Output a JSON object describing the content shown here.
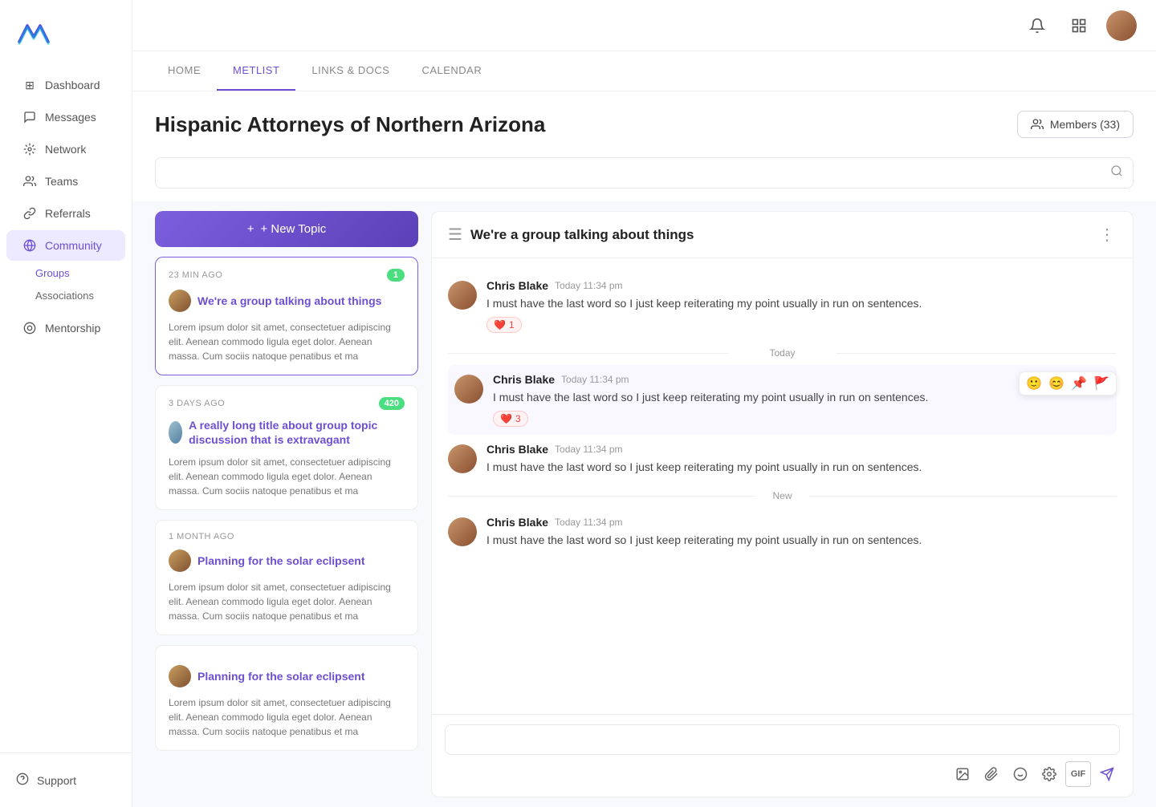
{
  "app": {
    "logo_alt": "App Logo"
  },
  "sidebar": {
    "items": [
      {
        "id": "dashboard",
        "label": "Dashboard",
        "icon": "⊞"
      },
      {
        "id": "messages",
        "label": "Messages",
        "icon": "💬"
      },
      {
        "id": "network",
        "label": "Network",
        "icon": "⬡"
      },
      {
        "id": "teams",
        "label": "Teams",
        "icon": "👥"
      },
      {
        "id": "referrals",
        "label": "Referrals",
        "icon": "🔗"
      },
      {
        "id": "community",
        "label": "Community",
        "icon": "🌐",
        "active": true
      }
    ],
    "community_sub": [
      {
        "id": "groups",
        "label": "Groups",
        "active": true
      },
      {
        "id": "associations",
        "label": "Associations"
      }
    ],
    "bottom": [
      {
        "id": "mentorship",
        "label": "Mentorship",
        "icon": "◎"
      },
      {
        "id": "support",
        "label": "Support",
        "icon": "?"
      }
    ]
  },
  "tabs": [
    {
      "id": "home",
      "label": "HOME"
    },
    {
      "id": "metlist",
      "label": "METLIST",
      "active": true
    },
    {
      "id": "links_docs",
      "label": "LINKS & DOCS"
    },
    {
      "id": "calendar",
      "label": "CALENDAR"
    }
  ],
  "group": {
    "title": "Hispanic Attorneys of Northern Arizona",
    "members_label": "Members (33)"
  },
  "search": {
    "placeholder": ""
  },
  "new_topic_btn": "+ New Topic",
  "topics": [
    {
      "id": 1,
      "time": "23 MIN AGO",
      "badge": "1",
      "badge_color": "green",
      "title": "We're a group talking about things",
      "body": "Lorem ipsum dolor sit amet, consectetuer adipiscing elit. Aenean commodo ligula eget dolor. Aenean massa. Cum sociis natoque penatibus et ma",
      "active": true
    },
    {
      "id": 2,
      "time": "3 DAYS AGO",
      "badge": "420",
      "badge_color": "green",
      "title": "A really long title about group topic discussion that is extravagant",
      "body": "Lorem ipsum dolor sit amet, consectetuer adipiscing elit. Aenean commodo ligula eget dolor. Aenean massa. Cum sociis natoque penatibus et ma"
    },
    {
      "id": 3,
      "time": "1 MONTH AGO",
      "badge": "",
      "title": "Planning for the solar eclipsent",
      "body": "Lorem ipsum dolor sit amet, consectetuer adipiscing elit. Aenean commodo ligula eget dolor. Aenean massa. Cum sociis natoque penatibus et ma"
    },
    {
      "id": 4,
      "time": "",
      "badge": "",
      "title": "Planning for the solar eclipsent",
      "body": "Lorem ipsum dolor sit amet, consectetuer adipiscing elit. Aenean commodo ligula eget dolor. Aenean massa. Cum sociis natoque penatibus et ma"
    }
  ],
  "discussion": {
    "title": "We're a group talking about things",
    "messages": [
      {
        "id": 1,
        "author": "Chris Blake",
        "time": "Today 11:34 pm",
        "text": "I must have the last word so I just keep reiterating my point usually in run on sentences.",
        "reactions": [
          {
            "emoji": "❤️",
            "count": "1"
          }
        ],
        "show_divider_after": false
      },
      {
        "id": 2,
        "divider_before": "Today",
        "author": "Chris Blake",
        "time": "Today 11:34 pm",
        "text": "I must have the last word so I just keep reiterating my point usually in run on sentences.",
        "reactions": [
          {
            "emoji": "❤️",
            "count": "3"
          }
        ],
        "show_actions": true
      },
      {
        "id": 3,
        "author": "Chris Blake",
        "time": "Today 11:34 pm",
        "text": "I must have the last word so I just keep reiterating my point usually in run on sentences.",
        "reactions": [],
        "divider_after": "New"
      },
      {
        "id": 4,
        "divider_before": "New",
        "author": "Chris Blake",
        "time": "Today 11:34 pm",
        "text": "I must have the last word so I just keep reiterating my point usually in run on sentences.",
        "reactions": []
      }
    ]
  },
  "input": {
    "placeholder": "",
    "tools": [
      "🖼️",
      "📎",
      "😊",
      "⚙️",
      "GIF",
      "➤"
    ]
  }
}
